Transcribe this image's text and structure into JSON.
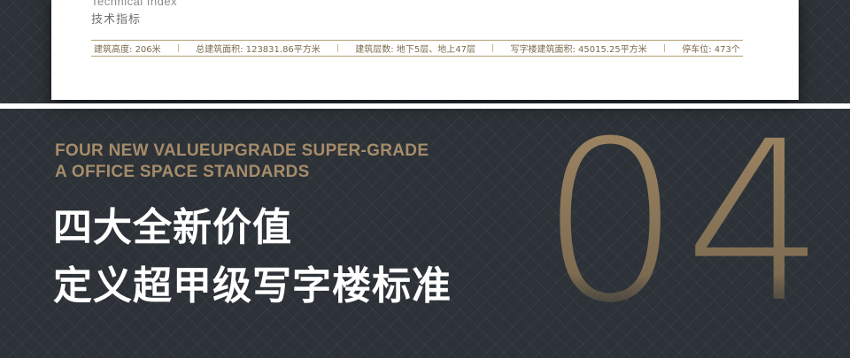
{
  "card": {
    "title_en": "Technical Index",
    "title_cn": "技术指标",
    "specs": [
      {
        "label": "建筑高度:",
        "value": "206米"
      },
      {
        "label": "总建筑面积:",
        "value": "123831.86平方米"
      },
      {
        "label": "建筑层数:",
        "value": "地下5层、地上47层"
      },
      {
        "label": "写字楼建筑面积:",
        "value": "45015.25平方米"
      },
      {
        "label": "停车位:",
        "value": "473个"
      }
    ]
  },
  "section": {
    "subtitle_line1": "FOUR NEW VALUEUPGRADE SUPER-GRADE",
    "subtitle_line2": "A OFFICE SPACE STANDARDS",
    "heading_line1": "四大全新价值",
    "heading_line2": "定义超甲级写字楼标准",
    "number": "04"
  },
  "colors": {
    "background": "#2c3237",
    "gold": "#a68c6a",
    "spec_text": "#7b6a4c",
    "heading": "#ffffff"
  }
}
